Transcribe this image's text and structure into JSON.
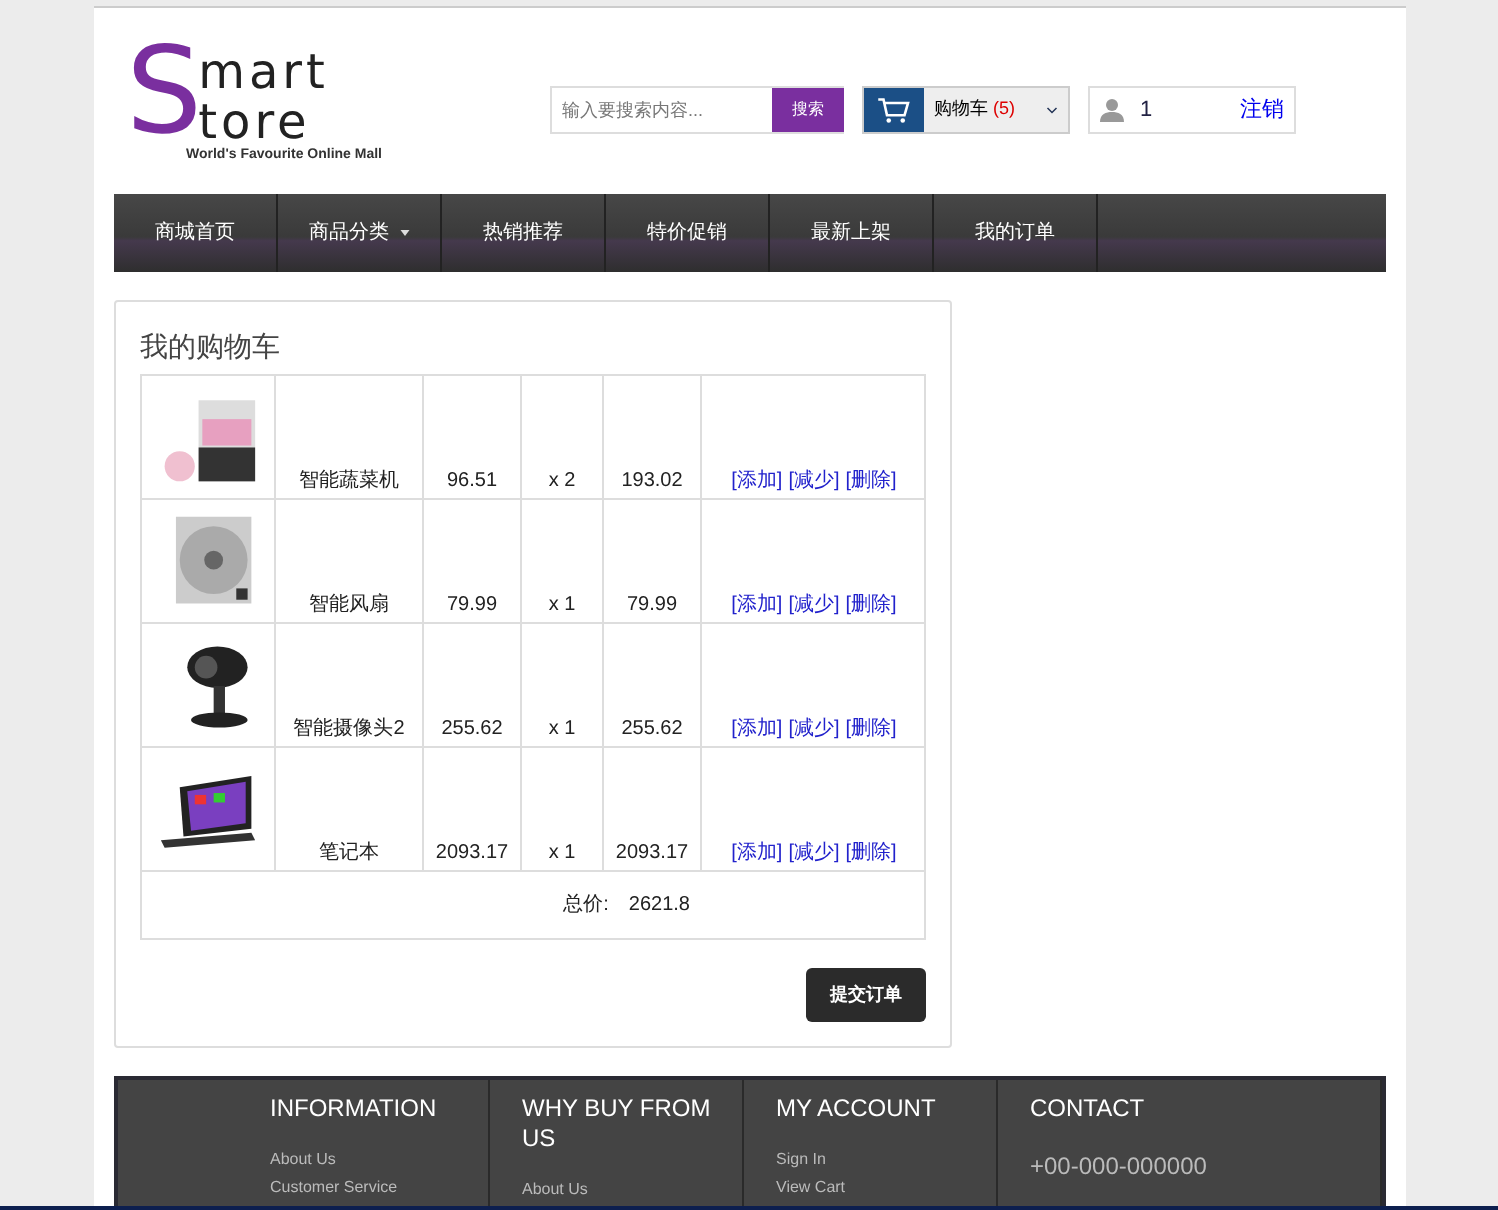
{
  "logo": {
    "big_letter_1": "S",
    "line_1": "mart",
    "line_2": "tore",
    "tagline": "World's Favourite Online Mall"
  },
  "search": {
    "placeholder": "输入要搜索内容...",
    "button": "搜索"
  },
  "cart": {
    "label": "购物车",
    "count": "(5)"
  },
  "user": {
    "name": "1",
    "logout": "注销"
  },
  "nav": [
    {
      "label": "商城首页",
      "dropdown": false
    },
    {
      "label": "商品分类",
      "dropdown": true
    },
    {
      "label": "热销推荐",
      "dropdown": false
    },
    {
      "label": "特价促销",
      "dropdown": false
    },
    {
      "label": "最新上架",
      "dropdown": false
    },
    {
      "label": "我的订单",
      "dropdown": false
    }
  ],
  "cart_panel": {
    "title": "我的购物车",
    "rows": [
      {
        "name": "智能蔬菜机",
        "price": "96.51",
        "qty": "x 2",
        "subtotal": "193.02",
        "actions": [
          "[添加]",
          "[减少]",
          "[删除]"
        ]
      },
      {
        "name": "智能风扇",
        "price": "79.99",
        "qty": "x 1",
        "subtotal": "79.99",
        "actions": [
          "[添加]",
          "[减少]",
          "[删除]"
        ]
      },
      {
        "name": "智能摄像头2",
        "price": "255.62",
        "qty": "x 1",
        "subtotal": "255.62",
        "actions": [
          "[添加]",
          "[减少]",
          "[删除]"
        ]
      },
      {
        "name": "笔记本",
        "price": "2093.17",
        "qty": "x 1",
        "subtotal": "2093.17",
        "actions": [
          "[添加]",
          "[减少]",
          "[删除]"
        ]
      }
    ],
    "total_label": "总价:",
    "total": "2621.8",
    "submit": "提交订单"
  },
  "footer": [
    {
      "title": "INFORMATION",
      "links": [
        "About Us",
        "Customer Service"
      ]
    },
    {
      "title": "WHY BUY FROM US",
      "links": [
        "About Us"
      ]
    },
    {
      "title": "MY ACCOUNT",
      "links": [
        "Sign In",
        "View Cart"
      ]
    },
    {
      "title": "CONTACT",
      "links": [
        "+00-000-000000"
      ]
    }
  ]
}
